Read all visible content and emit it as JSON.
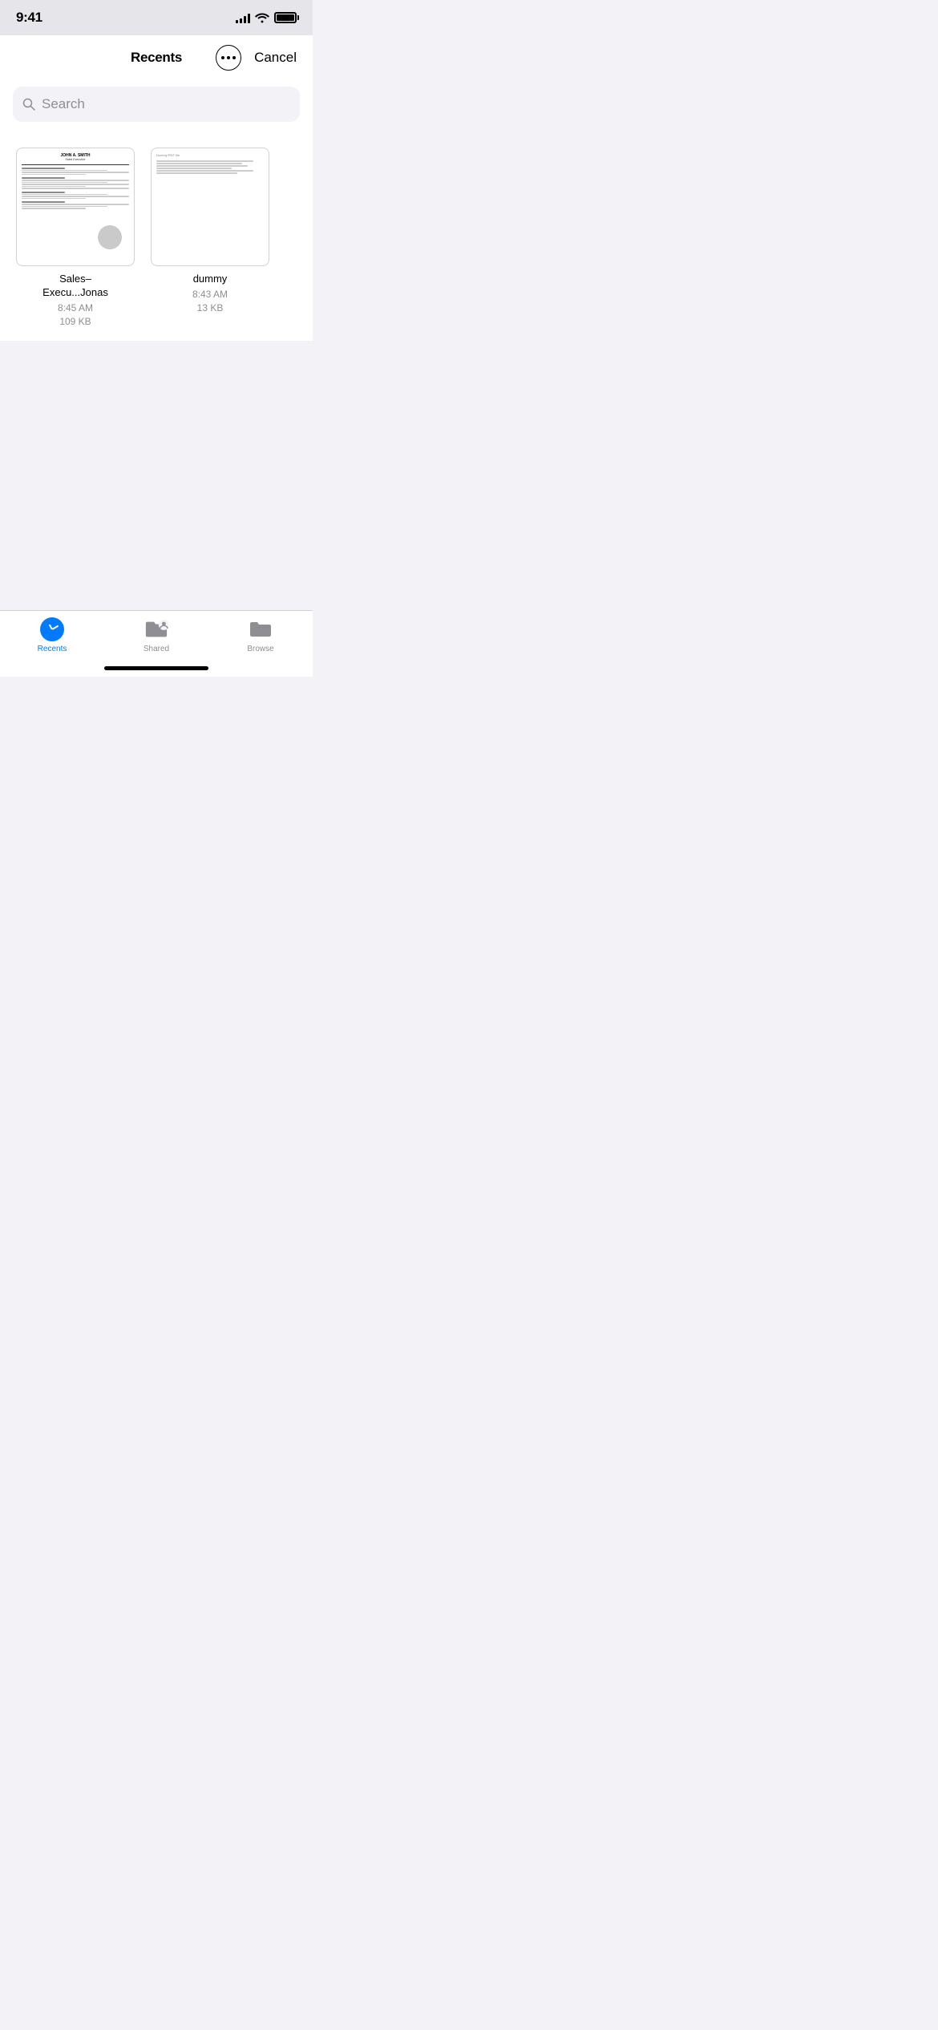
{
  "statusBar": {
    "time": "9:41",
    "signalBars": [
      4,
      6,
      9,
      12,
      14
    ],
    "wifiLabel": "wifi",
    "batteryLabel": "battery"
  },
  "navBar": {
    "title": "Recents",
    "moreLabel": "more",
    "cancelLabel": "Cancel"
  },
  "search": {
    "placeholder": "Search"
  },
  "files": [
    {
      "name": "Sales–\nExecu...Jonas",
      "time": "8:45 AM",
      "size": "109 KB",
      "type": "resume"
    },
    {
      "name": "dummy",
      "time": "8:43 AM",
      "size": "13 KB",
      "type": "pdf"
    }
  ],
  "tabBar": {
    "tabs": [
      {
        "id": "recents",
        "label": "Recents",
        "active": true
      },
      {
        "id": "shared",
        "label": "Shared",
        "active": false
      },
      {
        "id": "browse",
        "label": "Browse",
        "active": false
      }
    ]
  }
}
